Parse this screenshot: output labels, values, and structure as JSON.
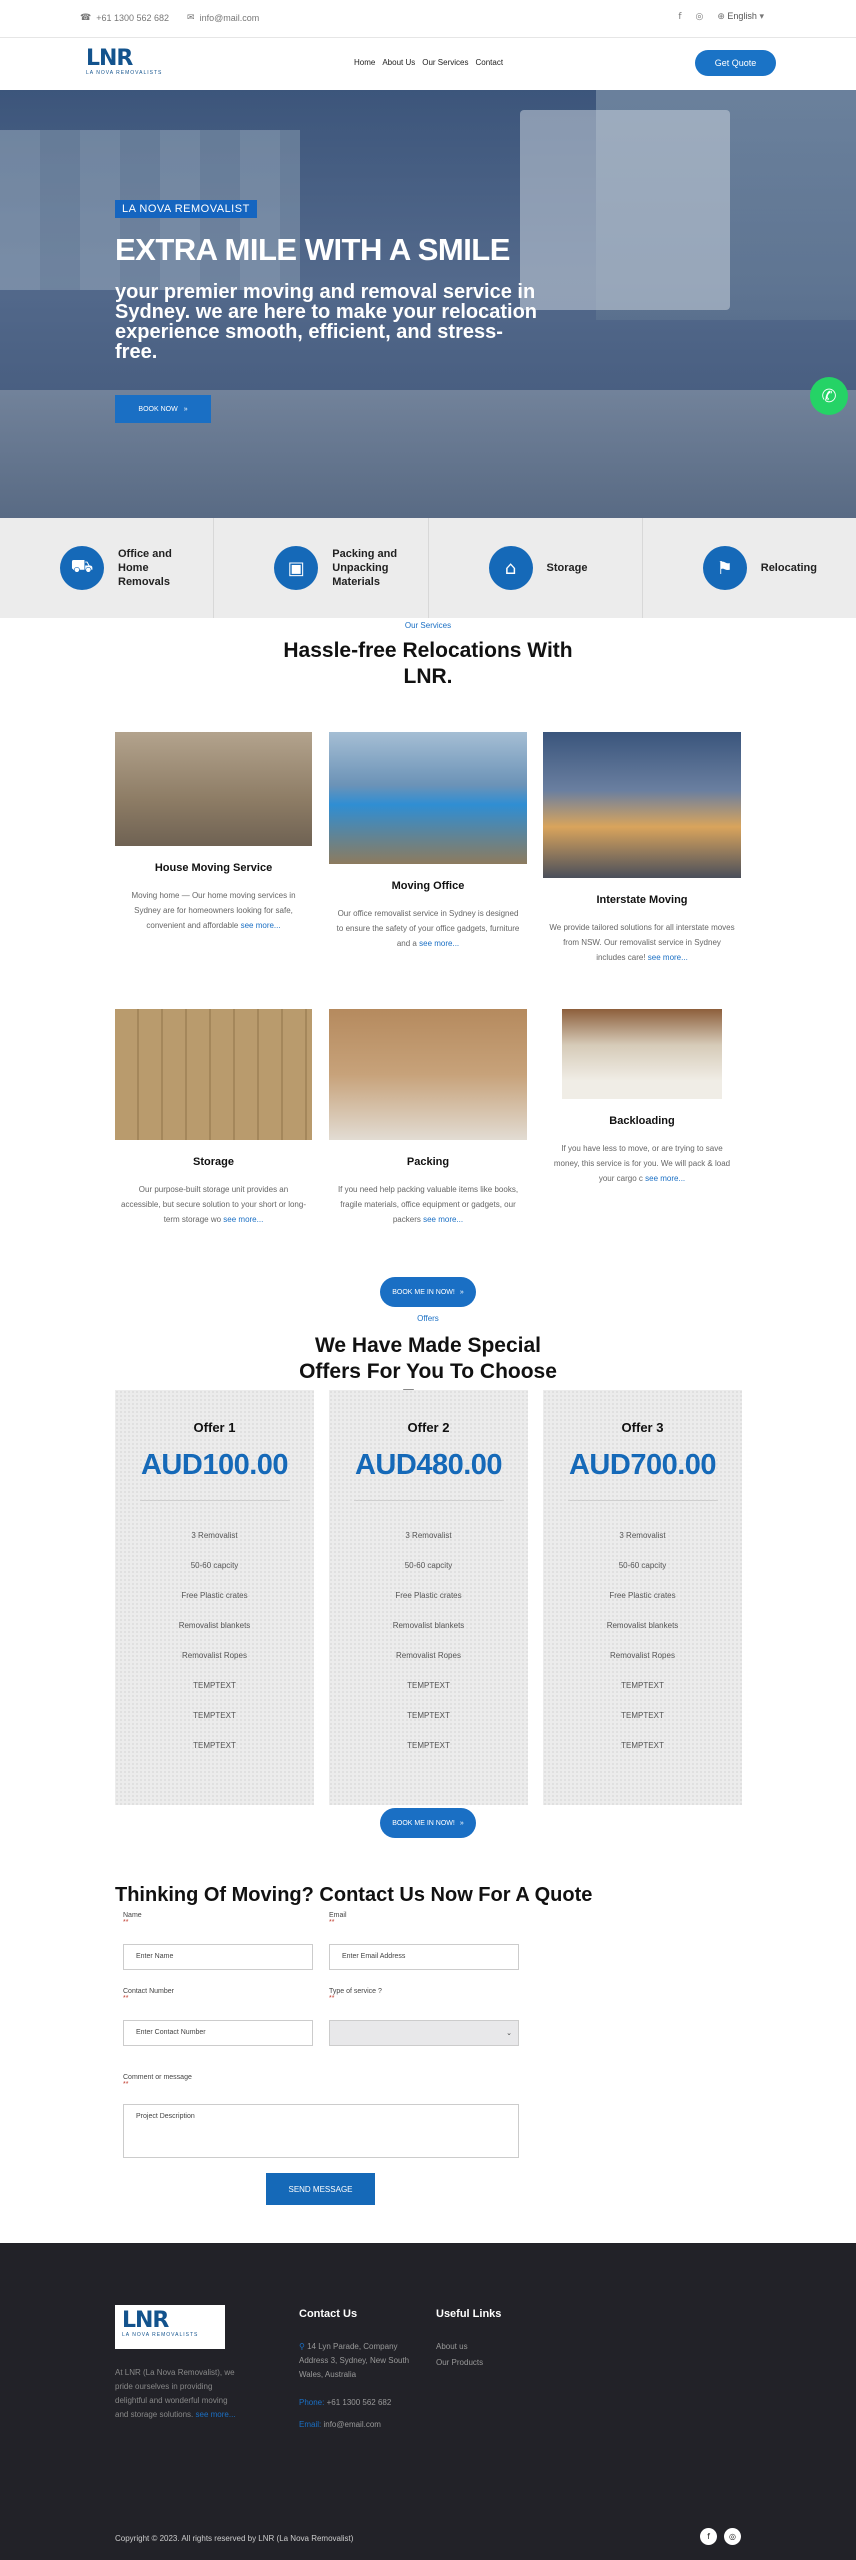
{
  "topbar": {
    "phone": "+61 1300 562 682",
    "email": "info@mail.com",
    "language": "English"
  },
  "nav": {
    "logo_text": "LNR",
    "logo_sub": "LA NOVA REMOVALISTS",
    "items": [
      "Home",
      "About Us",
      "Our Services",
      "Contact"
    ],
    "cta": "Get Quote"
  },
  "hero": {
    "badge": "LA NOVA REMOVALIST",
    "title": "EXTRA MILE WITH A SMILE",
    "subtitle": "your premier moving and removal service in Sydney. we are here to make your relocation experience smooth, efficient, and stress-free.",
    "button": "BOOK NOW"
  },
  "features": [
    {
      "label": "Office and Home Removals",
      "icon": "truck-icon"
    },
    {
      "label": "Packing and Unpacking Materials",
      "icon": "box-icon"
    },
    {
      "label": "Storage",
      "icon": "warehouse-icon"
    },
    {
      "label": "Relocating",
      "icon": "map-icon"
    }
  ],
  "services": {
    "eyebrow": "Our Services",
    "title": "Hassle-free Relocations With LNR.",
    "items": [
      {
        "title": "House Moving Service",
        "desc": "Moving home — Our home moving services in Sydney are for homeowners looking for safe, convenient and affordable",
        "more": "see more..."
      },
      {
        "title": "Moving Office",
        "desc": "Our office removalist service in Sydney is designed to ensure the safety of your office gadgets, furniture and a",
        "more": "see more..."
      },
      {
        "title": "Interstate Moving",
        "desc": "We provide tailored solutions for all interstate moves from NSW. Our removalist service in Sydney includes care!",
        "more": "see more..."
      },
      {
        "title": "Storage",
        "desc": "Our purpose-built storage unit provides an accessible, but secure solution to your short or long-term storage wo",
        "more": "see more..."
      },
      {
        "title": "Packing",
        "desc": "If you need help packing valuable items like books, fragile materials, office equipment or gadgets, our packers",
        "more": "see more..."
      },
      {
        "title": "Backloading",
        "desc": "If you have less to move, or are trying to save money, this service is for you. We will pack & load your cargo c",
        "more": "see more..."
      }
    ],
    "button": "BOOK ME IN NOW!"
  },
  "offers": {
    "eyebrow": "Offers",
    "title": "We Have Made Special Offers For You To Choose From",
    "items": [
      {
        "name": "Offer 1",
        "price": "AUD100.00",
        "features": [
          "3 Removalist",
          "50-60 capcity",
          "Free Plastic crates",
          "Removalist blankets",
          "Removalist Ropes",
          "TEMPTEXT",
          "TEMPTEXT",
          "TEMPTEXT"
        ]
      },
      {
        "name": "Offer 2",
        "price": "AUD480.00",
        "features": [
          "3 Removalist",
          "50-60 capcity",
          "Free Plastic crates",
          "Removalist blankets",
          "Removalist Ropes",
          "TEMPTEXT",
          "TEMPTEXT",
          "TEMPTEXT"
        ]
      },
      {
        "name": "Offer 3",
        "price": "AUD700.00",
        "features": [
          "3 Removalist",
          "50-60 capcity",
          "Free Plastic crates",
          "Removalist blankets",
          "Removalist Ropes",
          "TEMPTEXT",
          "TEMPTEXT",
          "TEMPTEXT"
        ]
      }
    ],
    "button": "BOOK ME IN NOW!"
  },
  "form": {
    "title": "Thinking Of Moving? Contact Us Now For A Quote",
    "name_label": "Name",
    "name_placeholder": "Enter Name",
    "email_label": "Email",
    "email_placeholder": "Enter Email Address",
    "phone_label": "Contact Number",
    "phone_placeholder": "Enter Contact Number",
    "service_label": "Type of service ?",
    "comment_label": "Comment or message",
    "comment_placeholder": "Project Description",
    "required": "**",
    "submit": "SEND MESSAGE"
  },
  "footer": {
    "about": "At LNR (La Nova Removalist), we pride ourselves in providing delightful and wonderful moving and storage solutions.",
    "about_more": "see more...",
    "contact_heading": "Contact Us",
    "address": "14 Lyn Parade, Company Address 3, Sydney, New South Wales, Australia",
    "phone_key": "Phone:",
    "phone": "+61 1300 562 682",
    "email_key": "Email:",
    "email": "info@email.com",
    "links_heading": "Useful Links",
    "links": [
      "About us",
      "Our Products"
    ],
    "copyright": "Copyright © 2023. All rights reserved by LNR (La Nova Removalist)"
  }
}
